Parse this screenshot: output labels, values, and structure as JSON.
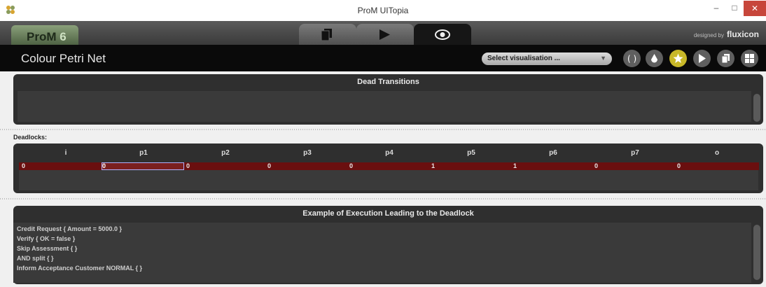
{
  "window": {
    "title": "ProM UITopia",
    "min": "–",
    "max": "□",
    "close": "✕"
  },
  "header": {
    "logo_text": "ProM",
    "logo_version": "6",
    "designed_by": "designed by",
    "brand": "fluxicon",
    "tabs": [
      {
        "icon": "documents-icon"
      },
      {
        "icon": "play-icon"
      },
      {
        "icon": "eye-icon",
        "active": true
      }
    ]
  },
  "toolbar": {
    "page_title": "Colour Petri Net",
    "select_placeholder": "Select visualisation ...",
    "select_arrow": "▼",
    "buttons": [
      "code-icon",
      "drop-icon",
      "star-icon",
      "play-icon",
      "copy-icon",
      "grid-icon"
    ],
    "active_button": "star-icon",
    "accent": "#c8b828"
  },
  "dead_transitions": {
    "title": "Dead Transitions"
  },
  "deadlocks": {
    "label": "Deadlocks:",
    "columns": [
      "i",
      "p1",
      "p2",
      "p3",
      "p4",
      "p5",
      "p6",
      "p7",
      "o"
    ],
    "values": [
      "0",
      "0",
      "0",
      "0",
      "0",
      "1",
      "1",
      "0",
      "0"
    ],
    "selected_index": 1,
    "row_color": "#6a0f0f"
  },
  "execution": {
    "title": "Example of Execution Leading to the Deadlock",
    "lines": [
      "Credit Request { Amount = 5000.0 }",
      "Verify { OK = false }",
      "Skip Assessment { }",
      "AND split { }",
      "Inform Acceptance Customer NORMAL { }"
    ]
  }
}
